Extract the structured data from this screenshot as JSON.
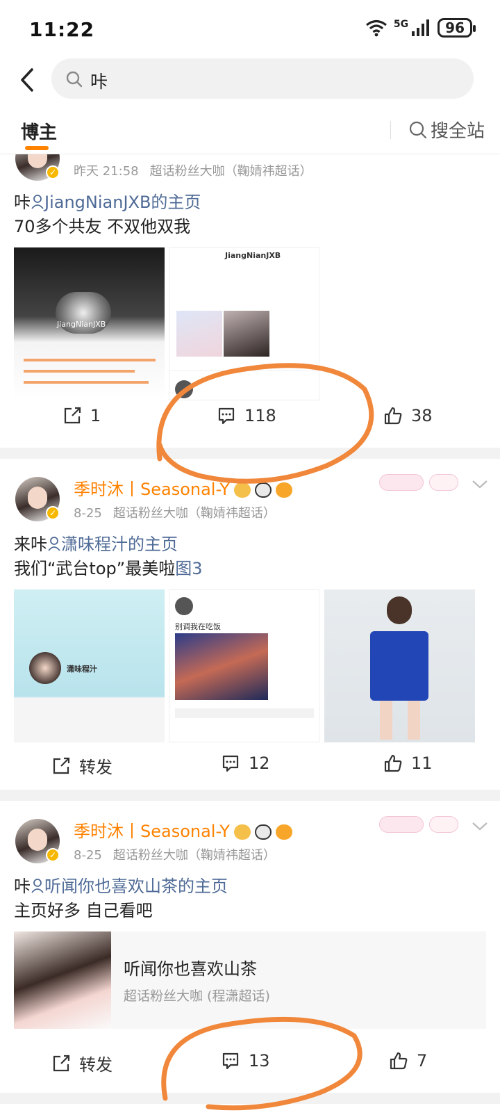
{
  "status": {
    "time": "11:22",
    "network": "5G",
    "battery": "96"
  },
  "search": {
    "query": "咔"
  },
  "tabs": {
    "active": "博主",
    "search_all": "搜全站"
  },
  "posts": [
    {
      "meta_time": "昨天 21:58",
      "meta_source": "超话粉丝大咖（鞠婧祎超话）",
      "text_prefix": "咔",
      "mention": "JiangNianJXB的主页",
      "line2": "70多个共友 不双他双我",
      "media_labels": [
        "JiangNianJXB",
        "JiangNianJXB"
      ],
      "repost": "1",
      "comments": "118",
      "likes": "38"
    },
    {
      "username": "季时沐丨Seasonal-Y",
      "meta_time": "8-25",
      "meta_source": "超话粉丝大咖（鞠婧祎超话）",
      "text_prefix": "来咔",
      "mention": "潇味程汁的主页",
      "line2_text": "我们“武台top”最美啦",
      "line2_link": "图3",
      "media_labels": [
        "潇味程汁",
        "别调我在吃饭"
      ],
      "repost": "转发",
      "comments": "12",
      "likes": "11"
    },
    {
      "username": "季时沐丨Seasonal-Y",
      "meta_time": "8-25",
      "meta_source": "超话粉丝大咖（鞠婧祎超话）",
      "text_prefix": "咔",
      "mention": "听闻你也喜欢山茶的主页",
      "line2": "主页好多 自己看吧",
      "card_title": "听闻你也喜欢山茶",
      "card_subtitle": "超话粉丝大咖 (程潇超话)",
      "repost": "转发",
      "comments": "13",
      "likes": "7"
    }
  ],
  "colors": {
    "accent": "#ff8200",
    "link": "#4e6a96",
    "annotation": "#f0873a"
  }
}
